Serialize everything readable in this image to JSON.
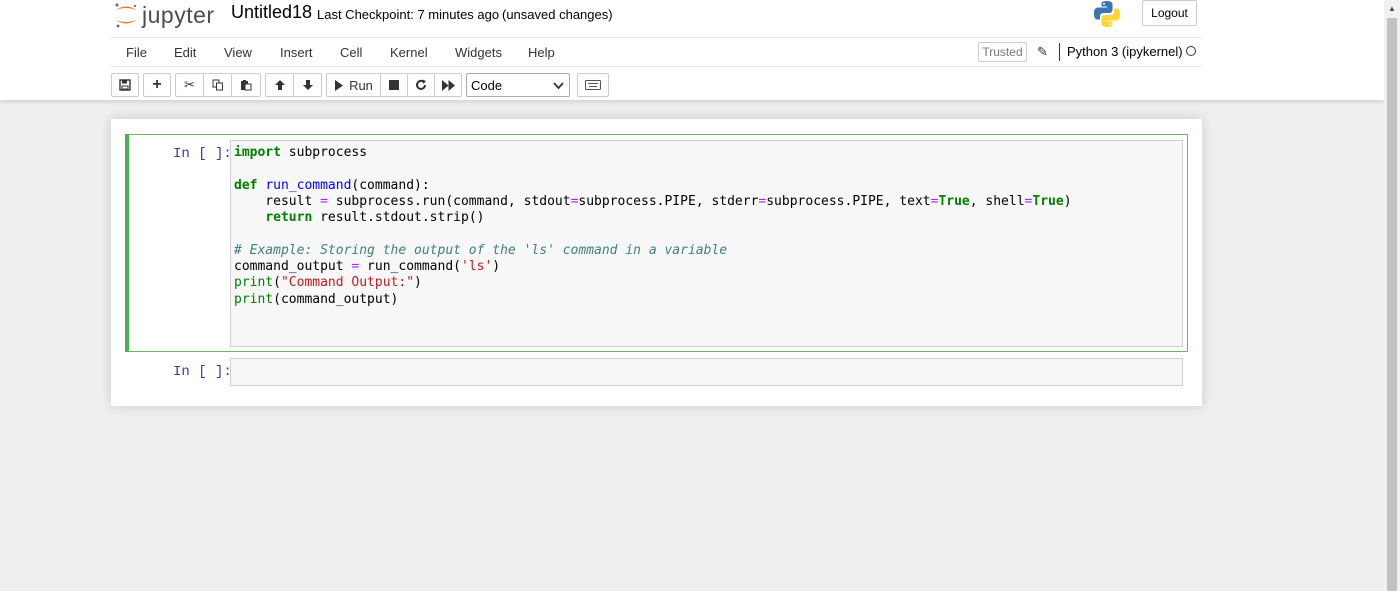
{
  "header": {
    "logo_text": "jupyter",
    "notebook_name": "Untitled18",
    "checkpoint": "Last Checkpoint: 7 minutes ago",
    "status": "(unsaved changes)",
    "logout_label": "Logout"
  },
  "menu": {
    "items": [
      "File",
      "Edit",
      "View",
      "Insert",
      "Cell",
      "Kernel",
      "Widgets",
      "Help"
    ],
    "trusted_label": "Trusted",
    "kernel_name": "Python 3 (ipykernel)"
  },
  "toolbar": {
    "run_label": "Run",
    "cell_type": "Code",
    "icons": [
      "save-icon",
      "plus-icon",
      "cut-icon",
      "copy-icon",
      "paste-icon",
      "arrow-up-icon",
      "arrow-down-icon",
      "run-icon",
      "stop-icon",
      "restart-icon",
      "fast-forward-icon",
      "keyboard-icon"
    ]
  },
  "cells": [
    {
      "prompt": "In [ ]:",
      "lines": [
        [
          "import",
          " subprocess"
        ],
        [
          ""
        ],
        [
          "def",
          " ",
          "run_command",
          "(command):"
        ],
        [
          "    result ",
          "=",
          " subprocess.run(command, stdout",
          "=",
          "subprocess.PIPE, stderr",
          "=",
          "subprocess.PIPE, text",
          "=",
          "True",
          ", shell",
          "=",
          "True",
          ")"
        ],
        [
          "    ",
          "return",
          " result.stdout.strip()"
        ],
        [
          ""
        ],
        [
          "# Example: Storing the output of the 'ls' command in a variable"
        ],
        [
          "command_output ",
          "=",
          " run_command(",
          "'ls'",
          ")"
        ],
        [
          "print",
          "(",
          "\"Command Output:\"",
          ")"
        ],
        [
          "print",
          "(command_output)"
        ]
      ]
    },
    {
      "prompt": "In [ ]:",
      "lines": []
    }
  ],
  "colors": {
    "selected_cell_border": "#66bb6a",
    "prompt": "#303f9f",
    "keyword": "#008000",
    "function_name": "#0000ff",
    "operator": "#aa22ff",
    "string": "#ba2121",
    "comment": "#408080",
    "logo_orange": "#f37726"
  }
}
